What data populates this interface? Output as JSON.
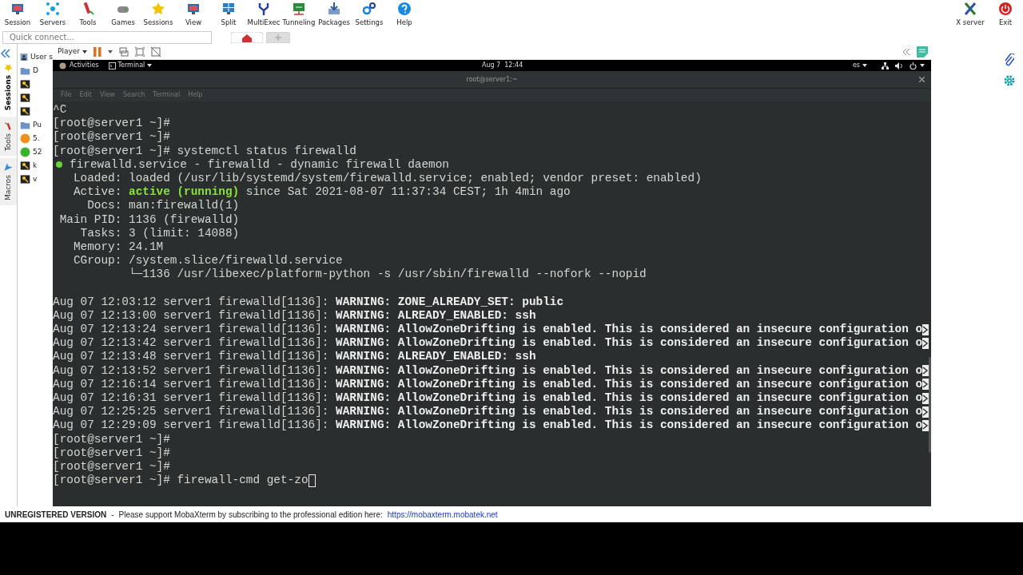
{
  "toolbar": [
    {
      "label": "Session"
    },
    {
      "label": "Servers"
    },
    {
      "label": "Tools"
    },
    {
      "label": "Games"
    },
    {
      "label": "Sessions"
    },
    {
      "label": "View"
    },
    {
      "label": "Split"
    },
    {
      "label": "MultiExec"
    },
    {
      "label": "Tunneling"
    },
    {
      "label": "Packages"
    },
    {
      "label": "Settings"
    },
    {
      "label": "Help"
    }
  ],
  "toolbar_right": [
    {
      "label": "X server"
    },
    {
      "label": "Exit"
    }
  ],
  "quick_connect": {
    "placeholder": "Quick connect..."
  },
  "side_tabs": [
    {
      "label": "Sessions",
      "selected": true
    },
    {
      "label": "Tools",
      "selected": false
    },
    {
      "label": "Macros",
      "selected": false
    }
  ],
  "session_tree": [
    {
      "kind": "user",
      "label": "User s"
    },
    {
      "kind": "folder",
      "label": "D"
    },
    {
      "kind": "key"
    },
    {
      "kind": "key"
    },
    {
      "kind": "key"
    },
    {
      "kind": "folder",
      "label": "Pu"
    },
    {
      "kind": "globe",
      "label": "5.",
      "color": "#f09020"
    },
    {
      "kind": "globe",
      "label": "52",
      "color": "#3cb030"
    },
    {
      "kind": "key",
      "label": "k"
    },
    {
      "kind": "key",
      "label": "v"
    }
  ],
  "player": {
    "label": "Player"
  },
  "gnome_bar": {
    "activities": "Activities",
    "app": "Terminal",
    "clock": "Aug 7  12:44",
    "keyboard": "es"
  },
  "terminal": {
    "title": "root@server1:~",
    "menu": [
      "File",
      "Edit",
      "View",
      "Search",
      "Terminal",
      "Help"
    ],
    "lines": [
      {
        "kind": "plain",
        "text": "^C"
      },
      {
        "kind": "plain",
        "text": "[root@server1 ~]#"
      },
      {
        "kind": "plain",
        "text": "[root@server1 ~]#"
      },
      {
        "kind": "plain",
        "text": "[root@server1 ~]# systemctl status firewalld"
      },
      {
        "kind": "unit",
        "text": "firewalld.service - firewalld - dynamic firewall daemon",
        "color": "#6ad33a"
      },
      {
        "kind": "plain",
        "text": "   Loaded: loaded (/usr/lib/systemd/system/firewalld.service; enabled; vendor preset: enabled)"
      },
      {
        "kind": "active",
        "prefix": "   Active: ",
        "status": "active (running)",
        "suffix": " since Sat 2021-08-07 11:37:34 CEST; 1h 4min ago"
      },
      {
        "kind": "plain",
        "text": "     Docs: man:firewalld(1)"
      },
      {
        "kind": "plain",
        "text": " Main PID: 1136 (firewalld)"
      },
      {
        "kind": "plain",
        "text": "    Tasks: 3 (limit: 14088)"
      },
      {
        "kind": "plain",
        "text": "   Memory: 24.1M"
      },
      {
        "kind": "plain",
        "text": "   CGroup: /system.slice/firewalld.service"
      },
      {
        "kind": "plain",
        "text": "           └─1136 /usr/libexec/platform-python -s /usr/sbin/firewalld --nofork --nopid"
      },
      {
        "kind": "blank"
      },
      {
        "kind": "log",
        "text": "Aug 07 12:03:12 server1 firewalld[1136]: **WARNING: ZONE_ALREADY_SET: public**",
        "truncated": false
      },
      {
        "kind": "log",
        "text": "Aug 07 12:13:00 server1 firewalld[1136]: **WARNING: ALREADY_ENABLED: ssh**",
        "truncated": false
      },
      {
        "kind": "log",
        "text": "Aug 07 12:13:24 server1 firewalld[1136]: **WARNING: AllowZoneDrifting is enabled. This is considered an insecure configuration o**",
        "truncated": true
      },
      {
        "kind": "log",
        "text": "Aug 07 12:13:42 server1 firewalld[1136]: **WARNING: AllowZoneDrifting is enabled. This is considered an insecure configuration o**",
        "truncated": true
      },
      {
        "kind": "log",
        "text": "Aug 07 12:13:48 server1 firewalld[1136]: **WARNING: ALREADY_ENABLED: ssh**",
        "truncated": false
      },
      {
        "kind": "log",
        "text": "Aug 07 12:13:52 server1 firewalld[1136]: **WARNING: AllowZoneDrifting is enabled. This is considered an insecure configuration o**",
        "truncated": true
      },
      {
        "kind": "log",
        "text": "Aug 07 12:16:14 server1 firewalld[1136]: **WARNING: AllowZoneDrifting is enabled. This is considered an insecure configuration o**",
        "truncated": true
      },
      {
        "kind": "log",
        "text": "Aug 07 12:16:31 server1 firewalld[1136]: **WARNING: AllowZoneDrifting is enabled. This is considered an insecure configuration o**",
        "truncated": true
      },
      {
        "kind": "log",
        "text": "Aug 07 12:25:25 server1 firewalld[1136]: **WARNING: AllowZoneDrifting is enabled. This is considered an insecure configuration o**",
        "truncated": true
      },
      {
        "kind": "log",
        "text": "Aug 07 12:29:09 server1 firewalld[1136]: **WARNING: AllowZoneDrifting is enabled. This is considered an insecure configuration o**",
        "truncated": true
      },
      {
        "kind": "plain",
        "text": "[root@server1 ~]#"
      },
      {
        "kind": "plain",
        "text": "[root@server1 ~]#"
      },
      {
        "kind": "plain",
        "text": "[root@server1 ~]#"
      },
      {
        "kind": "input",
        "text": "[root@server1 ~]# firewall-cmd get-zo",
        "cursor": true
      }
    ]
  },
  "status_bar": {
    "label": "UNREGISTERED VERSION",
    "separator": "-",
    "message": "Please support MobaXterm by subscribing to the professional edition here:",
    "link": "https://mobaxterm.mobatek.net"
  }
}
